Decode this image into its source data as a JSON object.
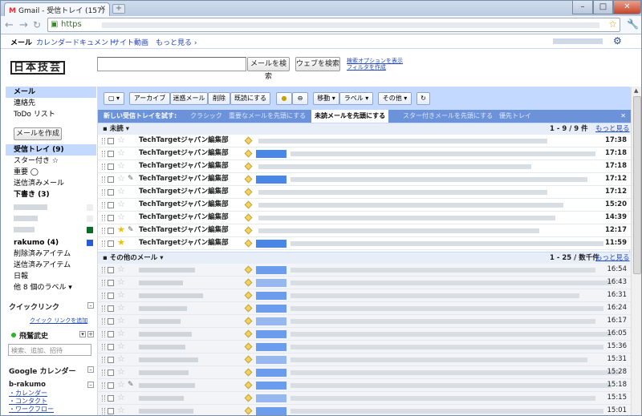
{
  "browser": {
    "tab_title": "Gmail - 受信トレイ (157)",
    "tab_gmark": "M",
    "url_scheme": "https",
    "back_icon": "arrow-left-icon",
    "forward_icon": "arrow-right-icon",
    "reload_icon": "reload-icon"
  },
  "gbar": {
    "items": [
      "メール",
      "カレンダー",
      "ドキュメント",
      "サイト",
      "動画",
      "もっと見る ›"
    ]
  },
  "logo_text": "日本技芸",
  "search": {
    "mail_button": "メールを検索",
    "web_button": "ウェブを検索",
    "options_line1": "検索オプションを表示",
    "options_line2": "フィルタを作成"
  },
  "sidebar": {
    "top_items": [
      "メール",
      "連絡先",
      "ToDo リスト"
    ],
    "compose": "メールを作成",
    "folders": [
      {
        "label": "受信トレイ (9)",
        "selected": true,
        "bold": true
      },
      {
        "label": "スター付き ☆",
        "bold": false
      },
      {
        "label": "重要 ◯",
        "bold": false
      },
      {
        "label": "送信済みメール",
        "bold": false
      },
      {
        "label": "下書き (3)",
        "bold": true
      }
    ],
    "labels2": [
      {
        "label": "rakumo (4)",
        "bold": true
      },
      {
        "label": "削除済みアイテム",
        "bold": false
      },
      {
        "label": "送信済みアイテム",
        "bold": false
      },
      {
        "label": "日報",
        "bold": false
      },
      {
        "label": "他 8 個のラベル ▾",
        "bold": false
      }
    ],
    "quicklinks_title": "クイックリンク",
    "quicklinks_add": "クイック リンクを追加",
    "chat_name": "飛鷲武史",
    "chat_placeholder": "検索、追加、招待",
    "calendar_title": "Google カレンダー",
    "brakumo_title": "b-rakumo",
    "brakumo_links": [
      "・カレンダー",
      "・コンタクト",
      "・ワークフロー"
    ]
  },
  "actions": {
    "archive": "アーカイブ",
    "spam": "迷惑メール",
    "delete": "削除",
    "mark_read": "既読にする",
    "move": "移動 ▾",
    "label": "ラベル ▾",
    "more": "その他 ▾",
    "refresh_icon": "refresh-icon"
  },
  "priority": {
    "title": "新しい受信トレイを試す:",
    "options": [
      "クラシック",
      "重要なメールを先頭にする",
      "未読メールを先頭にする",
      "スター付きメールを先頭にする",
      "優先トレイ"
    ],
    "current_index": 2
  },
  "unread_section": {
    "title": "未読",
    "count": "1 - 9 / 9 件",
    "more": "もっと見る",
    "rows": [
      {
        "sender": "TechTargetジャパン編集部",
        "time": "17:38",
        "star": false,
        "clip": false,
        "label": false
      },
      {
        "sender": "TechTargetジャパン編集部",
        "time": "17:18",
        "star": false,
        "clip": false,
        "label": true
      },
      {
        "sender": "TechTargetジャパン編集部",
        "time": "17:18",
        "star": false,
        "clip": false,
        "label": false
      },
      {
        "sender": "TechTargetジャパン編集部",
        "time": "17:12",
        "star": false,
        "clip": true,
        "label": true
      },
      {
        "sender": "TechTargetジャパン編集部",
        "time": "17:12",
        "star": false,
        "clip": false,
        "label": false
      },
      {
        "sender": "TechTargetジャパン編集部",
        "time": "15:20",
        "star": false,
        "clip": false,
        "label": false
      },
      {
        "sender": "TechTargetジャパン編集部",
        "time": "14:39",
        "star": false,
        "clip": false,
        "label": false
      },
      {
        "sender": "TechTargetジャパン編集部",
        "time": "12:17",
        "star": true,
        "clip": true,
        "label": false
      },
      {
        "sender": "TechTargetジャパン編集部",
        "time": "11:59",
        "star": true,
        "clip": false,
        "label": true
      }
    ]
  },
  "other_section": {
    "title": "その他のメール",
    "count": "1 - 25 / 数千件",
    "more": "もっと見る",
    "rows": [
      {
        "time": "16:54",
        "clip": false
      },
      {
        "time": "16:43",
        "clip": false
      },
      {
        "time": "16:31",
        "clip": false
      },
      {
        "time": "16:24",
        "clip": false
      },
      {
        "time": "16:17",
        "clip": false
      },
      {
        "time": "16:05",
        "clip": false
      },
      {
        "time": "15:36",
        "clip": false
      },
      {
        "time": "15:31",
        "clip": false
      },
      {
        "time": "15:28",
        "clip": false
      },
      {
        "time": "15:18",
        "clip": true
      },
      {
        "time": "15:15",
        "clip": false
      },
      {
        "time": "15:01",
        "clip": false
      },
      {
        "time": "14:55",
        "clip": false
      }
    ]
  },
  "colors": {
    "accent": "#c3d9ff",
    "priority_bar": "#6c93d9",
    "label_blue": "#4a86e8",
    "link": "#2244bb"
  }
}
